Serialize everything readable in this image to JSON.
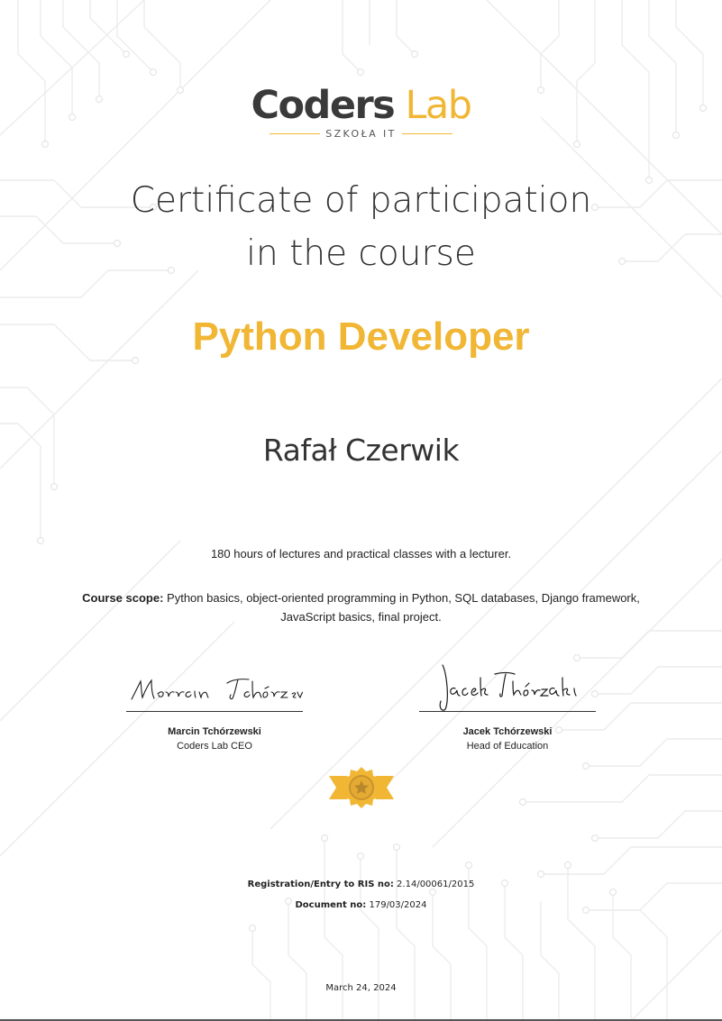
{
  "logo": {
    "word1": "Coders",
    "word2": "Lab",
    "subtitle": "SZKOŁA IT"
  },
  "title": {
    "line1": "Certificate of participation",
    "line2": "in the course"
  },
  "course_name": "Python Developer",
  "participant_name": "Rafał Czerwik",
  "hours_text": "180 hours of lectures and practical classes with a lecturer.",
  "scope": {
    "label": "Course scope:",
    "text": " Python basics, object-oriented programming in Python, SQL databases, Django framework, JavaScript basics, final project."
  },
  "signatures": [
    {
      "signature_text": "Marcin Tchórzewski",
      "name": "Marcin Tchórzewski",
      "role": "Coders Lab CEO"
    },
    {
      "signature_text": "Jacek Tchórzewski",
      "name": "Jacek  Tchórzewski",
      "role": "Head of Education"
    }
  ],
  "registration": {
    "label": "Registration/Entry to RIS no:",
    "value": " 2.14/00061/2015"
  },
  "document": {
    "label": "Document no:",
    "value": " 179/03/2024"
  },
  "date": "March 24, 2024",
  "colors": {
    "accent": "#f0b634",
    "dark_text": "#333333",
    "background_lines": "#ececec",
    "badge_gold": "#f0b634",
    "badge_dark": "#b8892a"
  },
  "icons": {
    "badge": "award-star-icon",
    "background": "circuit-pattern"
  }
}
